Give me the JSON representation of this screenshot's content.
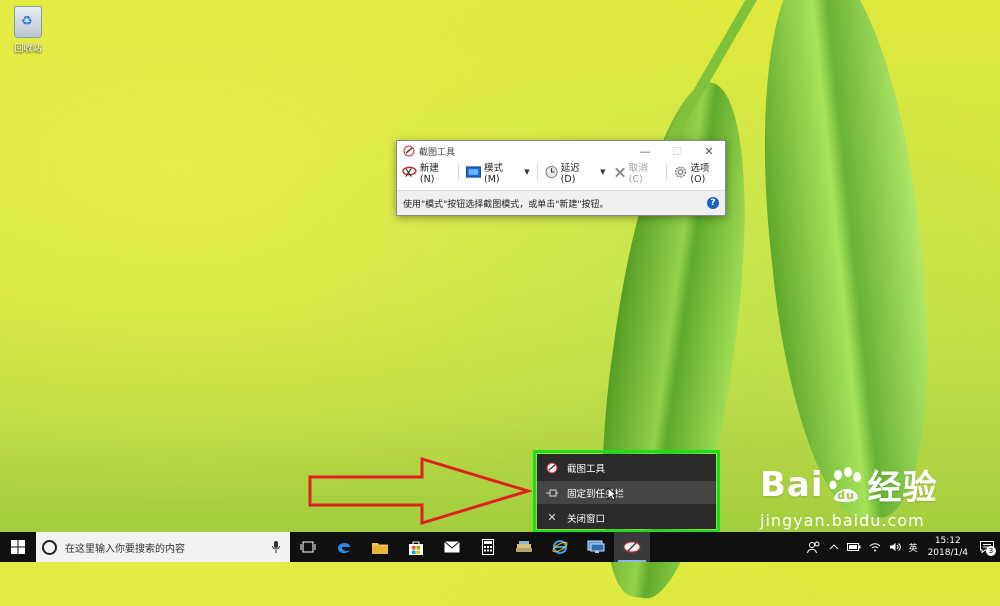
{
  "desktop": {
    "recycle_bin_label": "回收站"
  },
  "snipping_tool": {
    "title": "截图工具",
    "toolbar": {
      "new_label": "新建(N)",
      "mode_label": "模式(M)",
      "delay_label": "延迟(D)",
      "cancel_label": "取消(C)",
      "options_label": "选项(O)"
    },
    "status_text": "使用\"模式\"按钮选择截图模式，或单击\"新建\"按钮。",
    "help_icon": "?"
  },
  "jump_list": {
    "items": [
      {
        "label": "截图工具",
        "icon": "snipping-tool-icon"
      },
      {
        "label": "固定到任务栏",
        "icon": "pin-icon"
      },
      {
        "label": "关闭窗口",
        "icon": "close-icon"
      }
    ]
  },
  "taskbar": {
    "search_placeholder": "在这里输入你要搜索的内容",
    "apps": [
      "task-view",
      "edge",
      "file-explorer",
      "store",
      "mail",
      "calculator",
      "stack",
      "internet-explorer",
      "remote-desktop",
      "snipping-tool"
    ]
  },
  "tray": {
    "ime": "英",
    "time": "15:12",
    "date": "2018/1/4",
    "notification_count": "3"
  },
  "watermark": {
    "brand": "Baidu经验",
    "brand_left": "Bai",
    "brand_right": "经验",
    "url": "jingyan.baidu.com"
  },
  "colors": {
    "highlight_outline": "#15e11a",
    "arrow": "#e0201e",
    "taskbar": "#101010",
    "menu_bg": "#2b2b2b"
  }
}
